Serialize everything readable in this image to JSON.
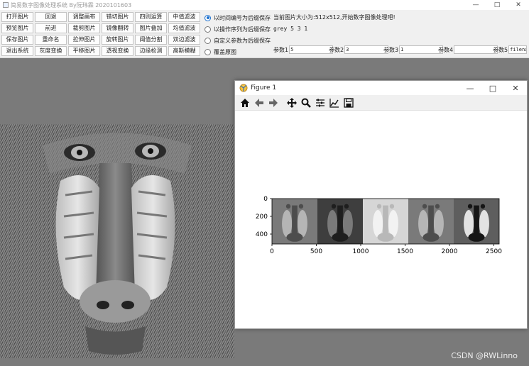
{
  "window": {
    "title": "简易数字图像处理系统 By阮玮霖 2020101603",
    "minimize": "—",
    "maximize": "□",
    "close": "✕"
  },
  "buttons": [
    [
      "打开图片",
      "回退",
      "调整画布",
      "错切图片",
      "四则运算",
      "中值滤波"
    ],
    [
      "预览图片",
      "前进",
      "裁剪图片",
      "镜像翻转",
      "图片叠加",
      "均值滤波"
    ],
    [
      "保存图片",
      "重命名",
      "拉伸图片",
      "旋转图片",
      "阈值分割",
      "双边滤波"
    ],
    [
      "退出系统",
      "灰度变换",
      "平移图片",
      "透视变换",
      "边缘检测",
      "高斯模糊"
    ]
  ],
  "save_modes": [
    {
      "label": "以时间编号为后缀保存",
      "selected": true
    },
    {
      "label": "以操作序列为后缀保存",
      "selected": false
    },
    {
      "label": "自定义参数为后缀保存",
      "selected": false
    },
    {
      "label": "覆盖原图",
      "selected": false
    }
  ],
  "status": "当前图片大小为:512x512,开始数字图像处理吧!",
  "history": "grey 5 3 1",
  "params": [
    {
      "label": "参数1",
      "value": "5"
    },
    {
      "label": "参数2",
      "value": "3"
    },
    {
      "label": "参数3",
      "value": "1"
    },
    {
      "label": "参数4",
      "value": ""
    },
    {
      "label": "参数5",
      "value": "filename"
    }
  ],
  "figure": {
    "title": "Figure 1",
    "toolbar": [
      "home-icon",
      "back-icon",
      "forward-icon",
      "pan-icon",
      "zoom-icon",
      "configure-icon",
      "edit-curve-icon",
      "save-icon"
    ]
  },
  "chart_data": {
    "type": "image",
    "xlim": [
      0,
      2560
    ],
    "ylim": [
      512,
      0
    ],
    "xticks": [
      0,
      500,
      1000,
      1500,
      2000,
      2500
    ],
    "yticks": [
      0,
      200,
      400
    ],
    "panels": [
      {
        "x0": 0,
        "x1": 512,
        "brightness": "medium"
      },
      {
        "x0": 512,
        "x1": 1024,
        "brightness": "dark"
      },
      {
        "x0": 1024,
        "x1": 1536,
        "brightness": "light"
      },
      {
        "x0": 1536,
        "x1": 2048,
        "brightness": "medium"
      },
      {
        "x0": 2048,
        "x1": 2560,
        "brightness": "high-contrast"
      }
    ]
  },
  "watermark": "CSDN @RWLinno",
  "colors": {
    "accent": "#1a6fce",
    "panel_bg": "#f0f0f0",
    "workspace": "#7a7a7a"
  }
}
